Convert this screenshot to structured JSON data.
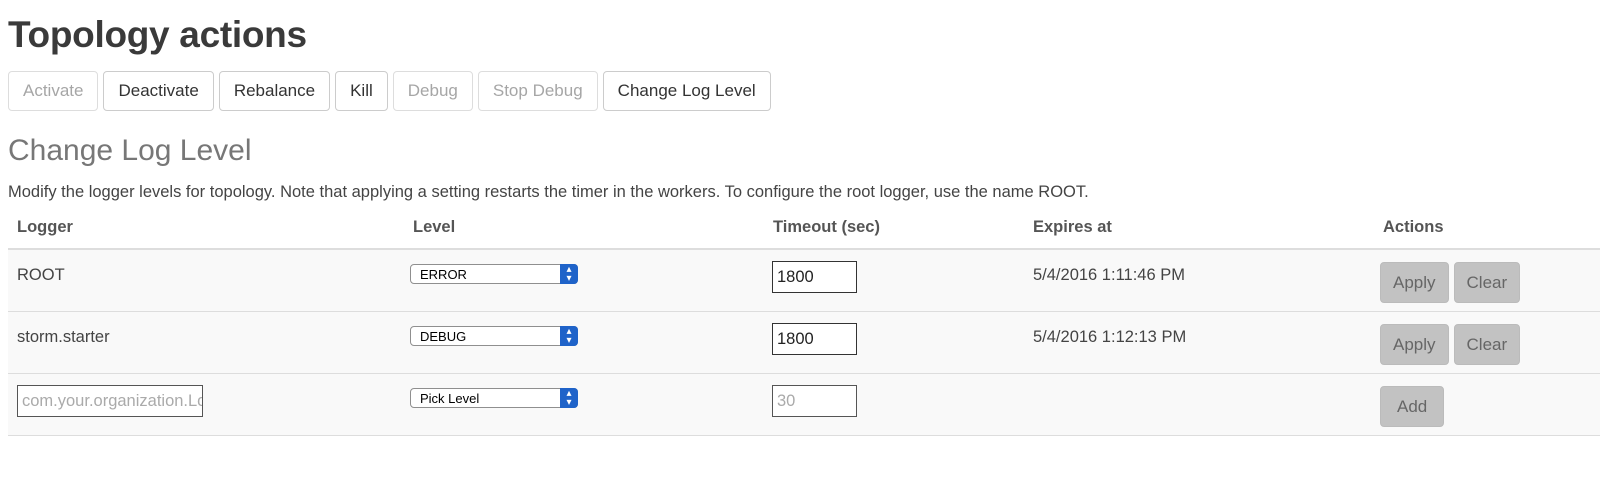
{
  "page": {
    "title": "Topology actions",
    "actions": [
      {
        "label": "Activate",
        "enabled": false
      },
      {
        "label": "Deactivate",
        "enabled": true
      },
      {
        "label": "Rebalance",
        "enabled": true
      },
      {
        "label": "Kill",
        "enabled": true
      },
      {
        "label": "Debug",
        "enabled": false
      },
      {
        "label": "Stop Debug",
        "enabled": false
      },
      {
        "label": "Change Log Level",
        "enabled": true
      }
    ]
  },
  "log_level": {
    "title": "Change Log Level",
    "description": "Modify the logger levels for topology. Note that applying a setting restarts the timer in the workers. To configure the root logger, use the name ROOT.",
    "columns": [
      "Logger",
      "Level",
      "Timeout (sec)",
      "Expires at",
      "Actions"
    ],
    "rows": [
      {
        "logger": "ROOT",
        "level": "ERROR",
        "timeout": "1800",
        "expires": "5/4/2016 1:11:46 PM",
        "apply_label": "Apply",
        "clear_label": "Clear"
      },
      {
        "logger": "storm.starter",
        "level": "DEBUG",
        "timeout": "1800",
        "expires": "5/4/2016 1:12:13 PM",
        "apply_label": "Apply",
        "clear_label": "Clear"
      }
    ],
    "new_row": {
      "logger_placeholder": "com.your.organization.LoggerName",
      "level": "Pick Level",
      "timeout_placeholder": "30",
      "add_label": "Add"
    }
  },
  "colors": {
    "select_arrow": "#1f63c9",
    "gray_button": "#c2c2c2",
    "row_background": "#f9f9f9"
  }
}
